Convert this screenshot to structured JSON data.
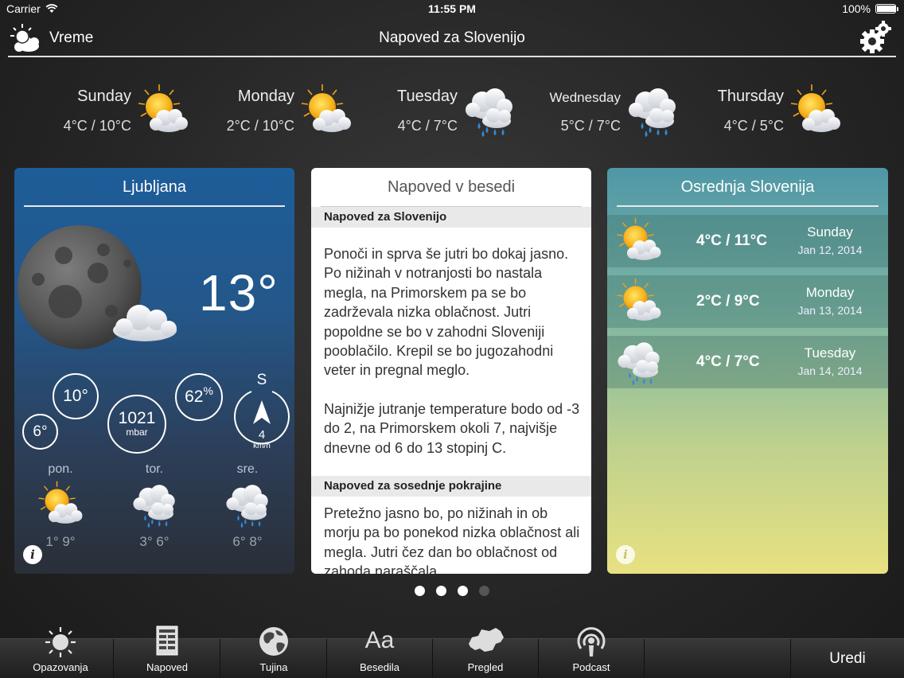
{
  "status_bar": {
    "carrier": "Carrier",
    "time": "11:55 PM",
    "battery": "100%"
  },
  "header": {
    "app_name": "Vreme",
    "title": "Napoved za Slovenijo",
    "icons": [
      "sun-cloud-icon",
      "gear-icon"
    ]
  },
  "days": [
    {
      "name": "Sunday",
      "temp": "4°C / 10°C",
      "icon": "sun-cloud-icon"
    },
    {
      "name": "Monday",
      "temp": "2°C / 10°C",
      "icon": "sun-cloud-icon"
    },
    {
      "name": "Tuesday",
      "temp": "4°C / 7°C",
      "icon": "rain-cloud-icon"
    },
    {
      "name": "Wednesday",
      "temp": "5°C / 7°C",
      "icon": "rain-cloud-icon"
    },
    {
      "name": "Thursday",
      "temp": "4°C / 5°C",
      "icon": "sun-cloud-icon"
    }
  ],
  "ljubljana": {
    "title": "Ljubljana",
    "current_temp": "13°",
    "max_temp": "10°",
    "min_temp": "6°",
    "pressure_value": "1021",
    "pressure_unit": "mbar",
    "humidity_value": "62",
    "humidity_unit": "%",
    "wind_dir": "S",
    "wind_speed": "4",
    "wind_unit": "km/h",
    "forecast": [
      {
        "name": "pon.",
        "temp": "1° 9°",
        "icon": "sun-cloud-icon"
      },
      {
        "name": "tor.",
        "temp": "3° 6°",
        "icon": "rain-cloud-icon"
      },
      {
        "name": "sre.",
        "temp": "6° 8°",
        "icon": "rain-cloud-icon"
      }
    ],
    "info": "i"
  },
  "text_forecast": {
    "title": "Napoved v besedi",
    "section1_title": "Napoved za Slovenijo",
    "section1_p1": "Ponoči in sprva še jutri bo dokaj jasno. Po nižinah v notranjosti bo nastala megla, na Primorskem pa se bo zadrževala nizka oblačnost. Jutri popoldne se bo v zahodni Sloveniji pooblačilo. Krepil se bo jugozahodni veter in pregnal meglo.",
    "section1_p2": "Najnižje jutranje temperature bodo od -3 do 2, na Primorskem okoli 7, najvišje dnevne od 6 do 13 stopinj C.",
    "section2_title": "Napoved za sosednje pokrajine",
    "section2_p1": "Pretežno jasno bo, po nižinah in ob morju pa bo ponekod nizka oblačnost ali megla. Jutri čez dan bo oblačnost od zahoda naraščala."
  },
  "osrednja": {
    "title": "Osrednja Slovenija",
    "rows": [
      {
        "temp": "4°C / 11°C",
        "day": "Sunday",
        "date": "Jan 12, 2014",
        "icon": "sun-cloud-icon"
      },
      {
        "temp": "2°C / 9°C",
        "day": "Monday",
        "date": "Jan 13, 2014",
        "icon": "sun-cloud-icon"
      },
      {
        "temp": "4°C / 7°C",
        "day": "Tuesday",
        "date": "Jan 14, 2014",
        "icon": "rain-cloud-icon"
      }
    ],
    "info": "i"
  },
  "page_dots": {
    "count": 4,
    "active": 0
  },
  "tabbar": {
    "tabs": [
      {
        "label": "Opazovanja",
        "icon": "sun-icon"
      },
      {
        "label": "Napoved",
        "icon": "document-icon"
      },
      {
        "label": "Tujina",
        "icon": "globe-icon"
      },
      {
        "label": "Besedila",
        "icon": "text-aa-icon"
      },
      {
        "label": "Pregled",
        "icon": "slovenia-map-icon"
      },
      {
        "label": "Podcast",
        "icon": "podcast-icon"
      }
    ],
    "edit_label": "Uredi",
    "aa_glyph": "Aa"
  }
}
